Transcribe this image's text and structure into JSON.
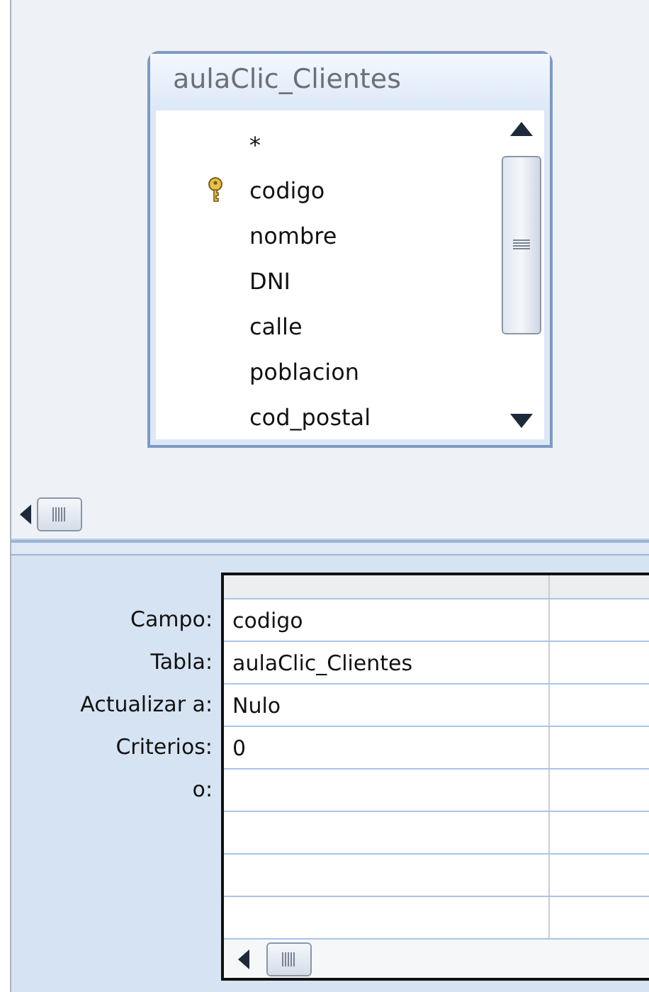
{
  "field_list": {
    "title": "aulaClic_Clientes",
    "fields": [
      {
        "name": "*",
        "primary_key": false
      },
      {
        "name": "codigo",
        "primary_key": true
      },
      {
        "name": "nombre",
        "primary_key": false
      },
      {
        "name": "DNI",
        "primary_key": false
      },
      {
        "name": "calle",
        "primary_key": false
      },
      {
        "name": "poblacion",
        "primary_key": false
      },
      {
        "name": "cod_postal",
        "primary_key": false
      }
    ]
  },
  "design_grid": {
    "rows": [
      {
        "label": "Campo:",
        "value": "codigo"
      },
      {
        "label": "Tabla:",
        "value": "aulaClic_Clientes"
      },
      {
        "label": "Actualizar a:",
        "value": "Nulo"
      },
      {
        "label": "Criterios:",
        "value": "0"
      },
      {
        "label": "o:"
      }
    ]
  }
}
